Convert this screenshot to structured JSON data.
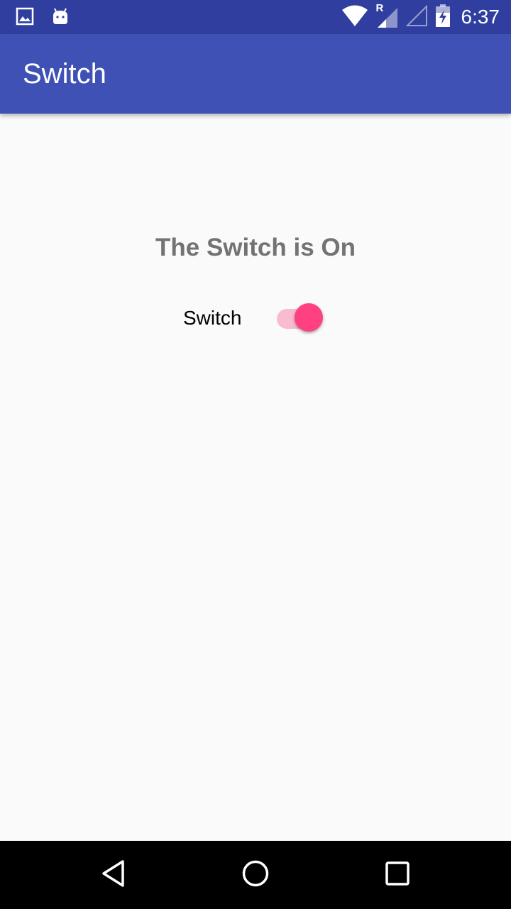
{
  "status_bar": {
    "time": "6:37",
    "network_label": "R",
    "icons": [
      "image-notification-icon",
      "android-notification-icon",
      "wifi-icon",
      "cell-signal-roaming-icon",
      "cell-signal-empty-icon",
      "battery-charging-icon"
    ],
    "background": "#303F9F"
  },
  "app_bar": {
    "title": "Switch",
    "background": "#3F51B5"
  },
  "main": {
    "status_message": "The Switch is On",
    "switch": {
      "label": "Switch",
      "checked": true,
      "accent_color": "#FF4081"
    }
  },
  "nav_bar": {
    "buttons": [
      "back-icon",
      "home-icon",
      "recents-icon"
    ]
  }
}
